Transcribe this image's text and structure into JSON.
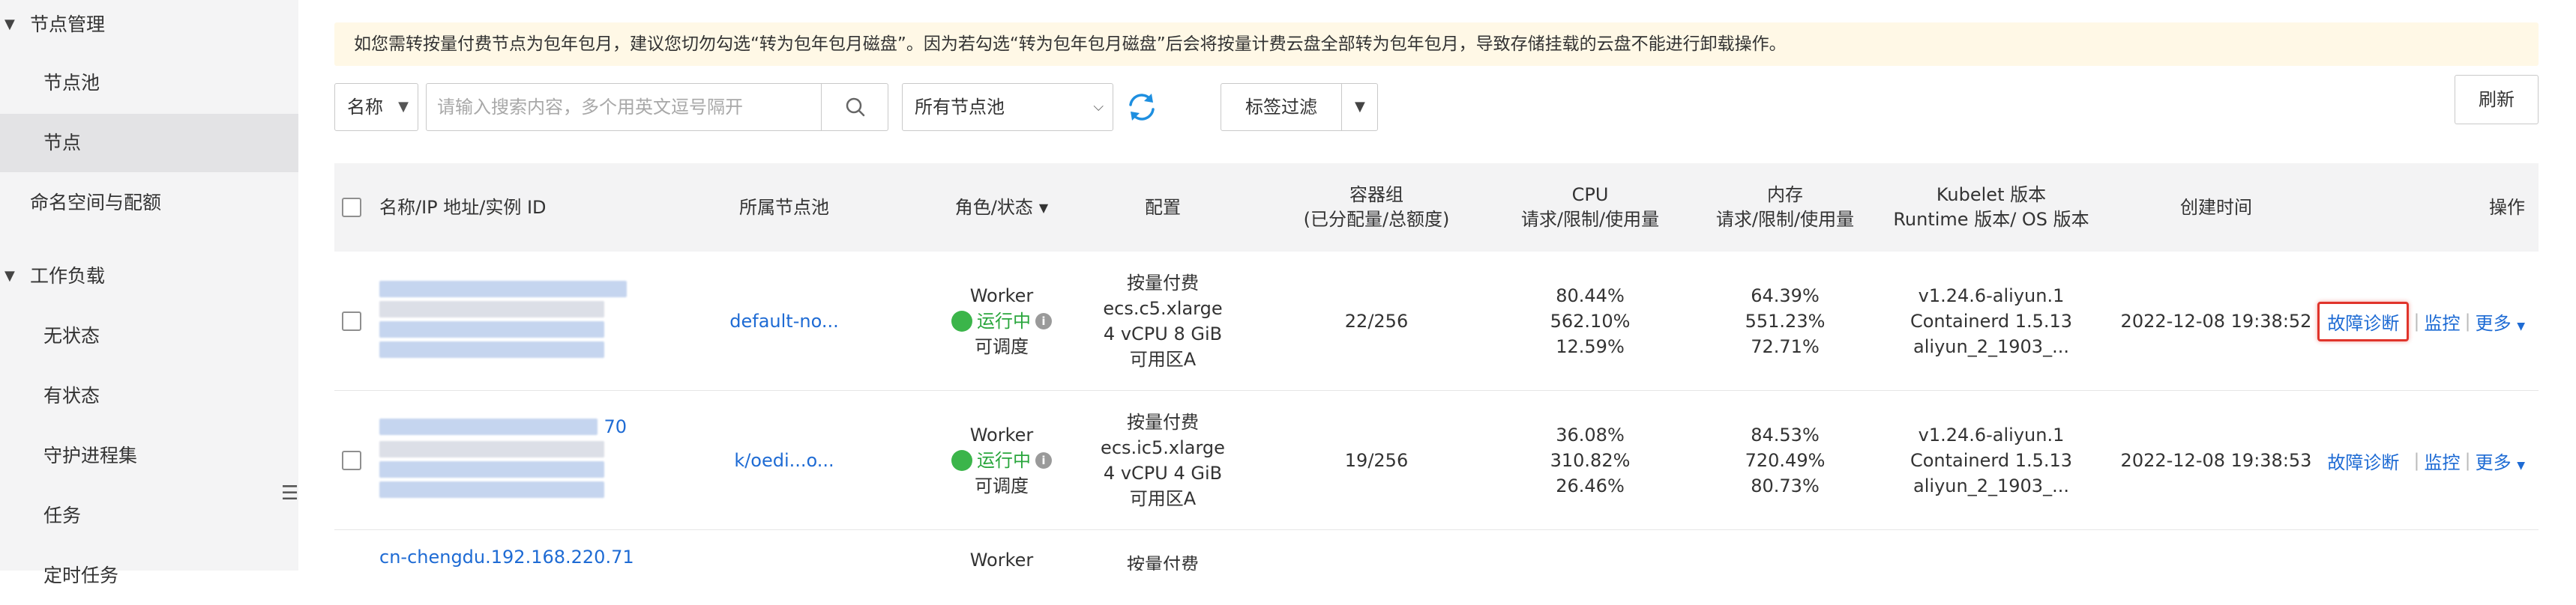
{
  "sidebar": {
    "groups": [
      {
        "label": "节点管理"
      },
      {
        "label": "工作负载"
      }
    ],
    "items": [
      {
        "label": "节点池"
      },
      {
        "label": "节点"
      },
      {
        "label": "命名空间与配额"
      },
      {
        "label": "无状态"
      },
      {
        "label": "有状态"
      },
      {
        "label": "守护进程集"
      },
      {
        "label": "任务"
      },
      {
        "label": "定时任务"
      }
    ]
  },
  "notice": {
    "text": "如您需转按量付费节点为包年包月，建议您切勿勾选“转为包年包月磁盘”。因为若勾选“转为包年包月磁盘”后会将按量计费云盘全部转为包年包月，导致存储挂载的云盘不能进行卸载操作。"
  },
  "toolbar": {
    "search_field": "名称",
    "search_placeholder": "请输入搜索内容，多个用英文逗号隔开",
    "nodepool_filter": "所有节点池",
    "tag_filter": "标签过滤",
    "refresh": "刷新"
  },
  "table": {
    "columns": {
      "name": "名称/IP 地址/实例 ID",
      "nodepool": "所属节点池",
      "role": "角色/状态",
      "config": "配置",
      "pods_l1": "容器组",
      "pods_l2": "(已分配量/总额度)",
      "cpu_l1": "CPU",
      "cpu_l2": "请求/限制/使用量",
      "mem_l1": "内存",
      "mem_l2": "请求/限制/使用量",
      "kubelet_l1": "Kubelet 版本",
      "kubelet_l2": "Runtime 版本/ OS 版本",
      "created": "创建时间",
      "actions": "操作"
    },
    "rows": [
      {
        "name_suffix": "",
        "nodepool": "default-no...",
        "role": "Worker",
        "status": "运行中",
        "schedule": "可调度",
        "billing": "按量付费",
        "instance": "ecs.c5.xlarge",
        "spec": "4 vCPU 8 GiB",
        "zone": "可用区A",
        "pods": "22/256",
        "cpu": [
          "80.44%",
          "562.10%",
          "12.59%"
        ],
        "mem": [
          "64.39%",
          "551.23%",
          "72.71%"
        ],
        "kubelet": "v1.24.6-aliyun.1",
        "runtime": "Containerd 1.5.13",
        "os": "aliyun_2_1903_...",
        "created": "2022-12-08 19:38:52",
        "diagnose": "故障诊断",
        "monitor": "监控",
        "more": "更多"
      },
      {
        "name_suffix": "70",
        "nodepool": "k/oedi...o...",
        "role": "Worker",
        "status": "运行中",
        "schedule": "可调度",
        "billing": "按量付费",
        "instance": "ecs.ic5.xlarge",
        "spec": "4 vCPU 4 GiB",
        "zone": "可用区A",
        "pods": "19/256",
        "cpu": [
          "36.08%",
          "310.82%",
          "26.46%"
        ],
        "mem": [
          "84.53%",
          "720.49%",
          "80.73%"
        ],
        "kubelet": "v1.24.6-aliyun.1",
        "runtime": "Containerd 1.5.13",
        "os": "aliyun_2_1903_...",
        "created": "2022-12-08 19:38:53",
        "diagnose": "故障诊断",
        "monitor": "监控",
        "more": "更多"
      },
      {
        "name": "cn-chengdu.192.168.220.71",
        "role": "Worker",
        "billing": "按量付费"
      }
    ]
  },
  "colors": {
    "link": "#1e6bd4",
    "running": "#3bb54a",
    "highlight": "#e0342b",
    "notice_bg": "#fff8e6"
  }
}
